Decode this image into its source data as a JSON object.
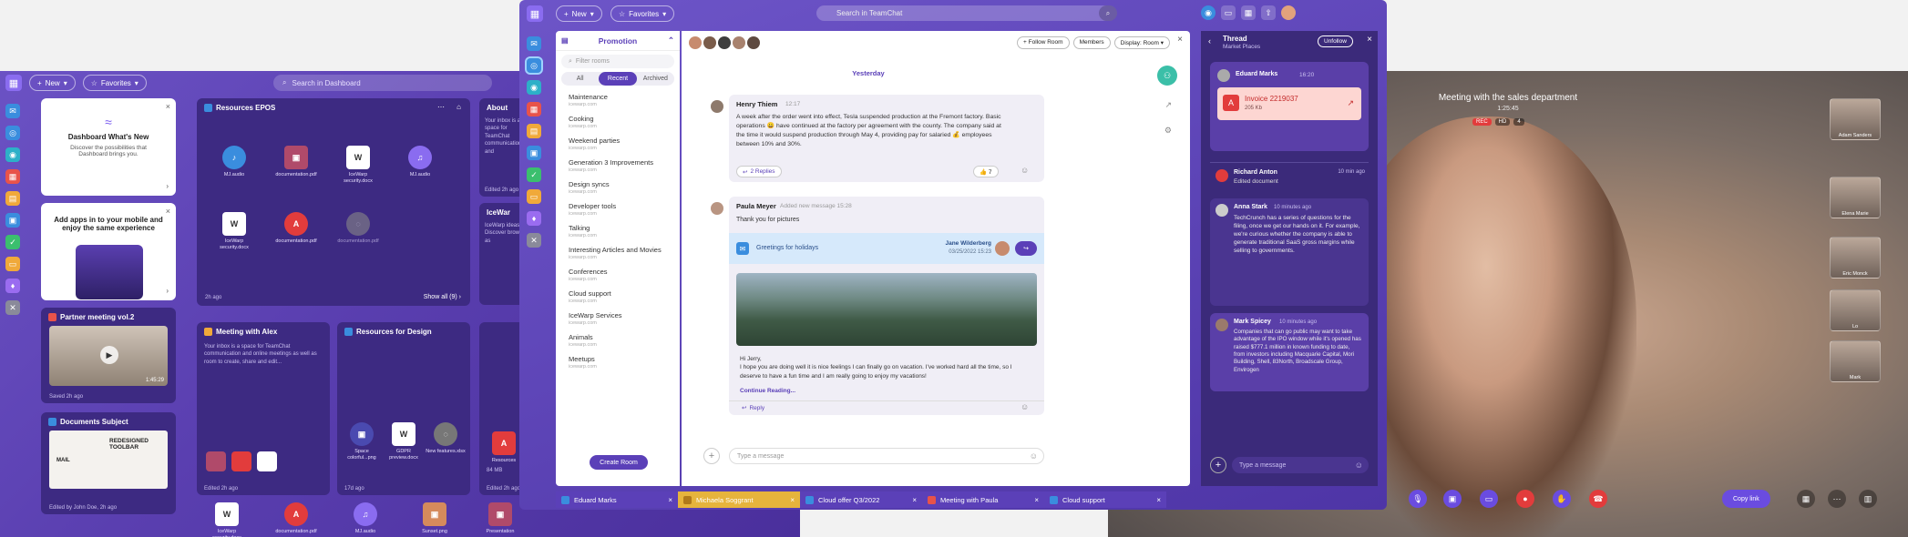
{
  "dashboard": {
    "new_label": "New",
    "favorites_label": "Favorites",
    "search_placeholder": "Search in Dashboard",
    "whats_new": {
      "title": "Dashboard What's New",
      "text": "Discover the possibilities that Dashboard brings you."
    },
    "add_apps": {
      "title": "Add apps in to your mobile and enjoy the same experience"
    },
    "partner_meeting": {
      "title": "Partner meeting vol.2",
      "duration": "1:45:29",
      "meta": "Saved 2h ago"
    },
    "documents_subject": {
      "title": "Documents Subject",
      "heading": "REDESIGNED TOOLBAR",
      "mail": "MAIL",
      "meta": "Edited by John Doe, 2h ago"
    },
    "resources_epos": {
      "title": "Resources EPOS",
      "files": [
        {
          "name": "MJ.audio"
        },
        {
          "name": "documentation.pdf"
        },
        {
          "name": "IceWarp security.docx"
        },
        {
          "name": "MJ.audio"
        },
        {
          "name": "IceWarp security.docx"
        },
        {
          "name": "documentation.pdf"
        },
        {
          "name": "documentation.pdf"
        }
      ],
      "meta": "2h ago",
      "show_all": "Show all (9)"
    },
    "about": {
      "title": "About",
      "text": "Your inbox is a space for TeamChat communication and",
      "meta": "Edited 2h ago"
    },
    "icewarp": {
      "title": "IceWar",
      "text": "IceWarp ideas. Discover browser, as",
      "meta": ""
    },
    "meeting_alex": {
      "title": "Meeting with Alex",
      "text": "Your inbox is a space for TeamChat communication and online meetings as well as room to create, share and edit...",
      "meta": "Edited 2h ago"
    },
    "resources_design": {
      "title": "Resources for Design",
      "files": [
        {
          "name": "Space colorful...png"
        },
        {
          "name": "GDPR preview.docx"
        },
        {
          "name": "New features.xlsx"
        }
      ],
      "meta": "17d ago"
    },
    "resources_small": {
      "name": "Resources",
      "size": "84 MB",
      "meta": "Edited 2h ago"
    },
    "bottom_files": [
      {
        "name": "IceWarp security.docx"
      },
      {
        "name": "documentation.pdf"
      },
      {
        "name": "MJ.audio"
      },
      {
        "name": "Sunset.png"
      },
      {
        "name": "Presentation"
      }
    ]
  },
  "teamchat": {
    "new_label": "New",
    "favorites_label": "Favorites",
    "search_placeholder": "Search in TeamChat",
    "group_title": "Promotion",
    "filter_placeholder": "Filter rooms",
    "filter_tabs": [
      "All",
      "Recent",
      "Archived"
    ],
    "rooms": [
      {
        "name": "Maintenance",
        "sub": "icewarp.com"
      },
      {
        "name": "Cooking",
        "sub": "icewarp.com"
      },
      {
        "name": "Weekend parties",
        "sub": "icewarp.com"
      },
      {
        "name": "Generation 3 Improvements",
        "sub": "icewarp.com"
      },
      {
        "name": "Design syncs",
        "sub": "icewarp.com"
      },
      {
        "name": "Developer tools",
        "sub": "icewarp.com"
      },
      {
        "name": "Talking",
        "sub": "icewarp.com"
      },
      {
        "name": "Interesting Articles and Movies",
        "sub": "icewarp.com"
      },
      {
        "name": "Conferences",
        "sub": "icewarp.com"
      },
      {
        "name": "Cloud support",
        "sub": "icewarp.com"
      },
      {
        "name": "IceWarp Services",
        "sub": "icewarp.com"
      },
      {
        "name": "Animals",
        "sub": "icewarp.com"
      },
      {
        "name": "Meetups",
        "sub": "icewarp.com"
      }
    ],
    "create_room": "Create Room",
    "header_buttons": {
      "follow": "+ Follow Room",
      "members": "Members",
      "display": "Display: Room"
    },
    "day_label": "Yesterday",
    "msg1": {
      "author": "Henry Thiem",
      "time": "12:17",
      "text": "A week after the order went into effect, Tesla suspended production at the Fremont factory. Basic operations 😀 have continued at the factory per agreement with the county. The company said at the time it would suspend production through May 4, providing pay for salaried 💰 employees between 10% and 30%.",
      "replies": "2 Replies",
      "reactions": "👍 7"
    },
    "msg2": {
      "author": "Paula Meyer",
      "action": "Added new message 15:28",
      "text": "Thank you for pictures",
      "card_title": "Greetings for holidays",
      "card_author": "Jane Wilderberg",
      "card_date": "03/25/2022 15:23",
      "body": "Hi Jerry,\nI hope you are doing well it is nice feelings I can finally go on vacation. I've worked hard all the time, so I deserve to have a fun time and I am really going to enjoy my vacations!",
      "continue": "Continue Reading...",
      "reply": "Reply"
    },
    "composer_placeholder": "Type a message",
    "thread": {
      "title": "Thread",
      "subtitle": "Market Places",
      "unfollow": "Unfollow",
      "first": {
        "author": "Eduard Marks",
        "time": "16:20",
        "file": "Invoice 2219037",
        "size": "205 Kb"
      },
      "items": [
        {
          "author": "Richard Anton",
          "time": "10 min ago",
          "text": "Edited document"
        },
        {
          "author": "Anna Stark",
          "time": "10 minutes ago",
          "text": "TechCrunch has a series of questions for the filing, once we get our hands on it. For example, we're curious whether the company is able to generate traditional SaaS gross margins while selling to governments."
        },
        {
          "author": "Mark Spicey",
          "time": "10 minutes ago",
          "text": "Companies that can go public may want to take advantage of the IPO window while it's opened has raised $777.1 million in known funding to date, from investors including Macquarie Capital, Mori Building, Shell, 83North, Broadscale Group, Envirogen"
        }
      ],
      "composer_placeholder": "Type a message"
    },
    "tabs": [
      {
        "label": "Eduard Marks",
        "color": "#5b40b8"
      },
      {
        "label": "Michaela Soggrant",
        "color": "#e6b43c"
      },
      {
        "label": "Cloud offer Q3/2022",
        "color": "#5b40b8"
      },
      {
        "label": "Meeting with Paula",
        "color": "#5b40b8"
      },
      {
        "label": "Cloud support",
        "color": "#5b40b8"
      }
    ]
  },
  "video": {
    "title": "Meeting with the sales department",
    "timer": "1:25:45",
    "badges": [
      "REC",
      "HD",
      "4"
    ],
    "participants": [
      {
        "name": "Adam Sanders"
      },
      {
        "name": "Elena Marie"
      },
      {
        "name": "Eric Monck"
      },
      {
        "name": "Lo"
      },
      {
        "name": "Mark"
      }
    ],
    "copy_link": "Copy link"
  }
}
